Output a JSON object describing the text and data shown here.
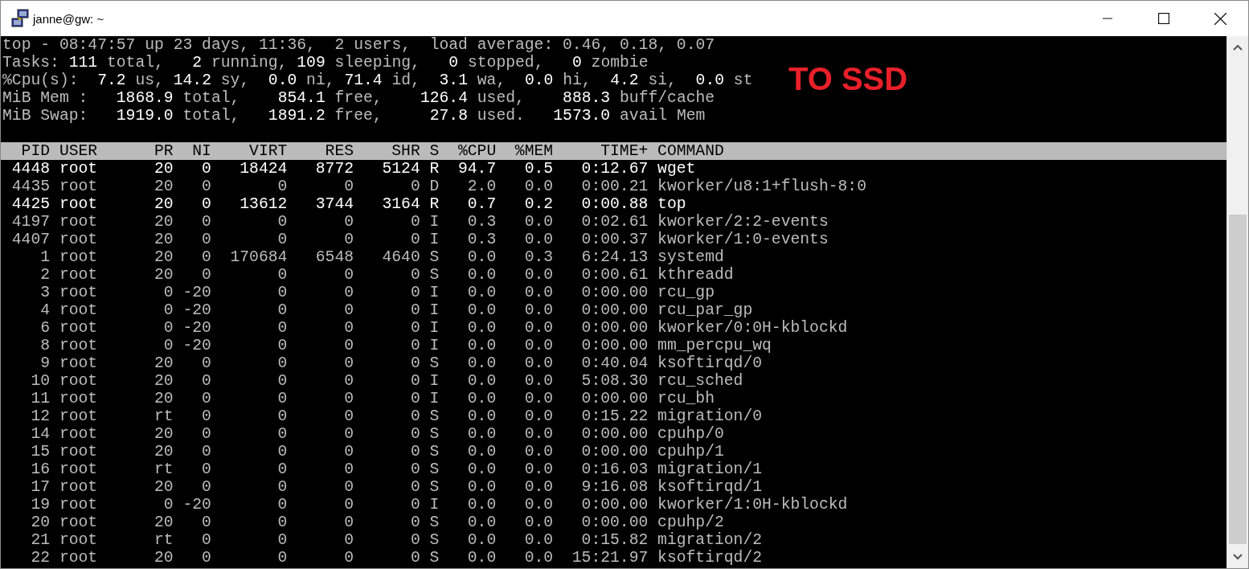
{
  "window": {
    "title": "janne@gw: ~"
  },
  "summary": [
    "top - 08:47:57 up 23 days, 11:36,  2 users,  load average: 0.46, 0.18, 0.07",
    "Tasks: **111** total,   **2** running, **109** sleeping,   **0** stopped,   **0** zombie",
    "%Cpu(s):  **7.2** us, **14.2** sy,  **0.0** ni, **71.4** id,  **3.1** wa,  **0.0** hi,  **4.2** si,  **0.0** st",
    "MiB Mem :   **1868.9** total,    **854.1** free,    **126.4** used,    **888.3** buff/cache",
    "MiB Swap:   **1919.0** total,   **1891.2** free,     **27.8** used.   **1573.0** avail Mem"
  ],
  "annotation": "TO SSD",
  "table": {
    "columns": [
      "PID",
      "USER",
      "PR",
      "NI",
      "VIRT",
      "RES",
      "SHR",
      "S",
      "%CPU",
      "%MEM",
      "TIME+",
      "COMMAND"
    ],
    "rows": [
      {
        "highlighted": true,
        "cells": [
          "4448",
          "root",
          "20",
          "0",
          "18424",
          "8772",
          "5124",
          "R",
          "94.7",
          "0.5",
          "0:12.67",
          "wget"
        ]
      },
      {
        "highlighted": false,
        "cells": [
          "4435",
          "root",
          "20",
          "0",
          "0",
          "0",
          "0",
          "D",
          "2.0",
          "0.0",
          "0:00.21",
          "kworker/u8:1+flush-8:0"
        ]
      },
      {
        "highlighted": true,
        "cells": [
          "4425",
          "root",
          "20",
          "0",
          "13612",
          "3744",
          "3164",
          "R",
          "0.7",
          "0.2",
          "0:00.88",
          "top"
        ]
      },
      {
        "highlighted": false,
        "cells": [
          "4197",
          "root",
          "20",
          "0",
          "0",
          "0",
          "0",
          "I",
          "0.3",
          "0.0",
          "0:02.61",
          "kworker/2:2-events"
        ]
      },
      {
        "highlighted": false,
        "cells": [
          "4407",
          "root",
          "20",
          "0",
          "0",
          "0",
          "0",
          "I",
          "0.3",
          "0.0",
          "0:00.37",
          "kworker/1:0-events"
        ]
      },
      {
        "highlighted": false,
        "cells": [
          "1",
          "root",
          "20",
          "0",
          "170684",
          "6548",
          "4640",
          "S",
          "0.0",
          "0.3",
          "6:24.13",
          "systemd"
        ]
      },
      {
        "highlighted": false,
        "cells": [
          "2",
          "root",
          "20",
          "0",
          "0",
          "0",
          "0",
          "S",
          "0.0",
          "0.0",
          "0:00.61",
          "kthreadd"
        ]
      },
      {
        "highlighted": false,
        "cells": [
          "3",
          "root",
          "0",
          "-20",
          "0",
          "0",
          "0",
          "I",
          "0.0",
          "0.0",
          "0:00.00",
          "rcu_gp"
        ]
      },
      {
        "highlighted": false,
        "cells": [
          "4",
          "root",
          "0",
          "-20",
          "0",
          "0",
          "0",
          "I",
          "0.0",
          "0.0",
          "0:00.00",
          "rcu_par_gp"
        ]
      },
      {
        "highlighted": false,
        "cells": [
          "6",
          "root",
          "0",
          "-20",
          "0",
          "0",
          "0",
          "I",
          "0.0",
          "0.0",
          "0:00.00",
          "kworker/0:0H-kblockd"
        ]
      },
      {
        "highlighted": false,
        "cells": [
          "8",
          "root",
          "0",
          "-20",
          "0",
          "0",
          "0",
          "I",
          "0.0",
          "0.0",
          "0:00.00",
          "mm_percpu_wq"
        ]
      },
      {
        "highlighted": false,
        "cells": [
          "9",
          "root",
          "20",
          "0",
          "0",
          "0",
          "0",
          "S",
          "0.0",
          "0.0",
          "0:40.04",
          "ksoftirqd/0"
        ]
      },
      {
        "highlighted": false,
        "cells": [
          "10",
          "root",
          "20",
          "0",
          "0",
          "0",
          "0",
          "I",
          "0.0",
          "0.0",
          "5:08.30",
          "rcu_sched"
        ]
      },
      {
        "highlighted": false,
        "cells": [
          "11",
          "root",
          "20",
          "0",
          "0",
          "0",
          "0",
          "I",
          "0.0",
          "0.0",
          "0:00.00",
          "rcu_bh"
        ]
      },
      {
        "highlighted": false,
        "cells": [
          "12",
          "root",
          "rt",
          "0",
          "0",
          "0",
          "0",
          "S",
          "0.0",
          "0.0",
          "0:15.22",
          "migration/0"
        ]
      },
      {
        "highlighted": false,
        "cells": [
          "14",
          "root",
          "20",
          "0",
          "0",
          "0",
          "0",
          "S",
          "0.0",
          "0.0",
          "0:00.00",
          "cpuhp/0"
        ]
      },
      {
        "highlighted": false,
        "cells": [
          "15",
          "root",
          "20",
          "0",
          "0",
          "0",
          "0",
          "S",
          "0.0",
          "0.0",
          "0:00.00",
          "cpuhp/1"
        ]
      },
      {
        "highlighted": false,
        "cells": [
          "16",
          "root",
          "rt",
          "0",
          "0",
          "0",
          "0",
          "S",
          "0.0",
          "0.0",
          "0:16.03",
          "migration/1"
        ]
      },
      {
        "highlighted": false,
        "cells": [
          "17",
          "root",
          "20",
          "0",
          "0",
          "0",
          "0",
          "S",
          "0.0",
          "0.0",
          "9:16.08",
          "ksoftirqd/1"
        ]
      },
      {
        "highlighted": false,
        "cells": [
          "19",
          "root",
          "0",
          "-20",
          "0",
          "0",
          "0",
          "I",
          "0.0",
          "0.0",
          "0:00.00",
          "kworker/1:0H-kblockd"
        ]
      },
      {
        "highlighted": false,
        "cells": [
          "20",
          "root",
          "20",
          "0",
          "0",
          "0",
          "0",
          "S",
          "0.0",
          "0.0",
          "0:00.00",
          "cpuhp/2"
        ]
      },
      {
        "highlighted": false,
        "cells": [
          "21",
          "root",
          "rt",
          "0",
          "0",
          "0",
          "0",
          "S",
          "0.0",
          "0.0",
          "0:15.82",
          "migration/2"
        ]
      },
      {
        "highlighted": false,
        "cells": [
          "22",
          "root",
          "20",
          "0",
          "0",
          "0",
          "0",
          "S",
          "0.0",
          "0.0",
          "15:21.97",
          "ksoftirqd/2"
        ]
      }
    ]
  }
}
